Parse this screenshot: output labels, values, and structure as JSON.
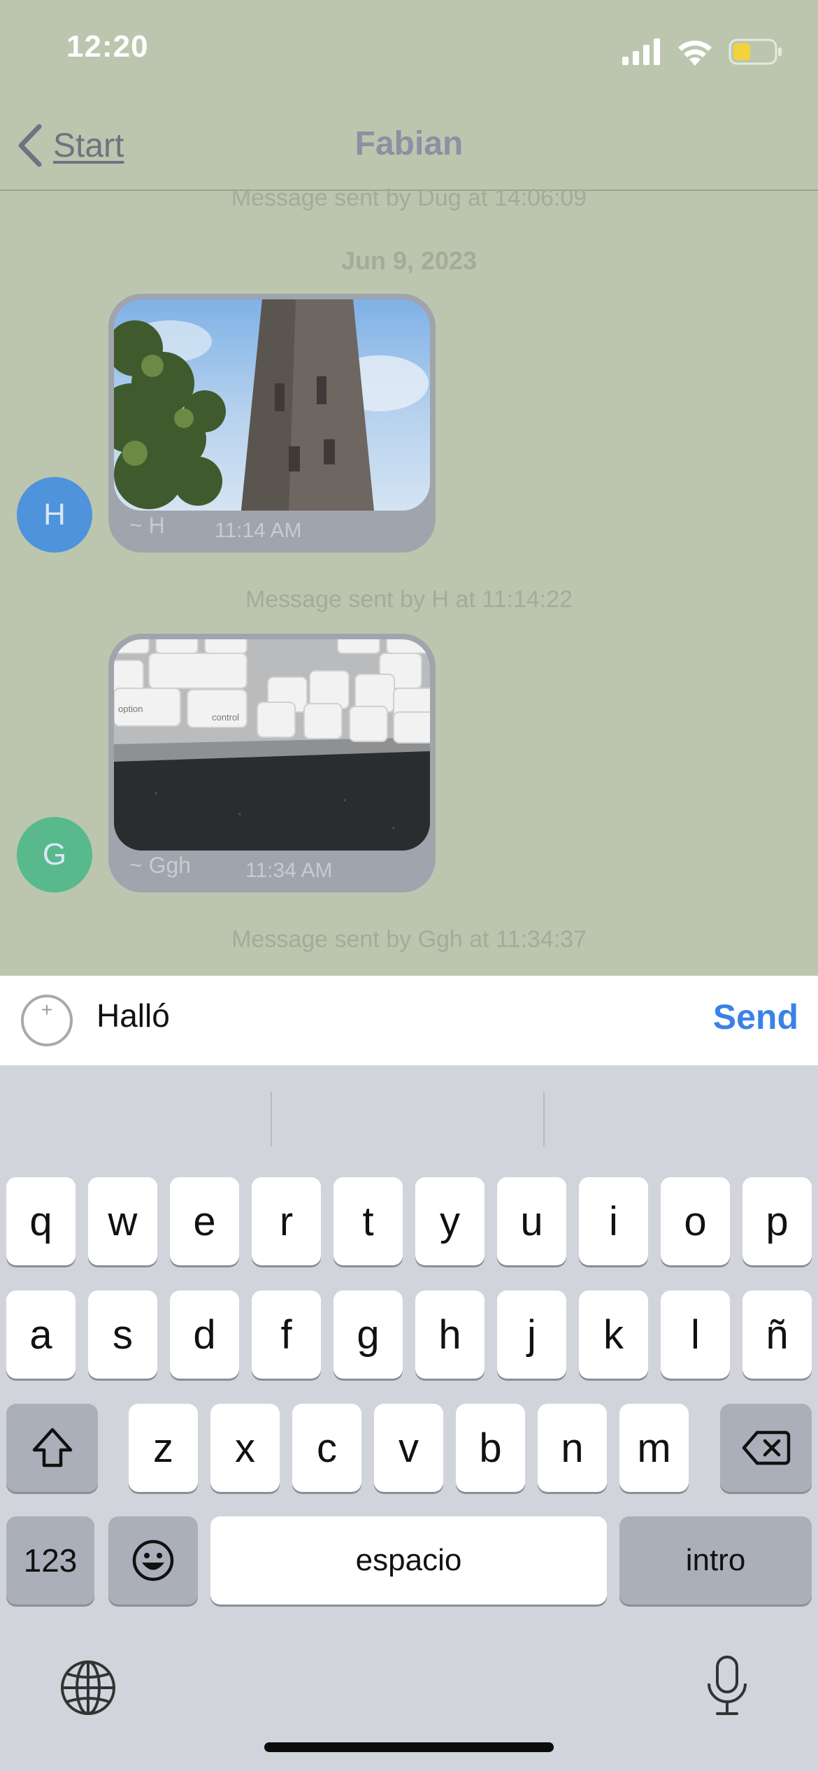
{
  "status_bar": {
    "time": "12:20",
    "battery_color": "#f3d23c"
  },
  "nav": {
    "back_label": "Start",
    "title": "Fabian"
  },
  "messages": {
    "top_system_msg": "Message sent by Dug at 14:06:09",
    "date_separator": "Jun 9, 2023",
    "items": [
      {
        "author": "~ H",
        "time": "11:14 AM",
        "avatar_letter": "H",
        "avatar_color": "#4e93dc",
        "system_msg": "Message sent by H at 11:14:22",
        "image": "tower-photo"
      },
      {
        "author": "~ Ggh",
        "time": "11:34 AM",
        "avatar_letter": "G",
        "avatar_color": "#57b98c",
        "system_msg": "Message sent by Ggh at 11:34:37",
        "image": "keyboard-photo"
      }
    ]
  },
  "compose": {
    "value": "Halló",
    "send_label": "Send"
  },
  "keyboard": {
    "row1": [
      "q",
      "w",
      "e",
      "r",
      "t",
      "y",
      "u",
      "i",
      "o",
      "p"
    ],
    "row2": [
      "a",
      "s",
      "d",
      "f",
      "g",
      "h",
      "j",
      "k",
      "l",
      "ñ"
    ],
    "row3": [
      "z",
      "x",
      "c",
      "v",
      "b",
      "n",
      "m"
    ],
    "numbers_label": "123",
    "space_label": "espacio",
    "return_label": "intro"
  }
}
